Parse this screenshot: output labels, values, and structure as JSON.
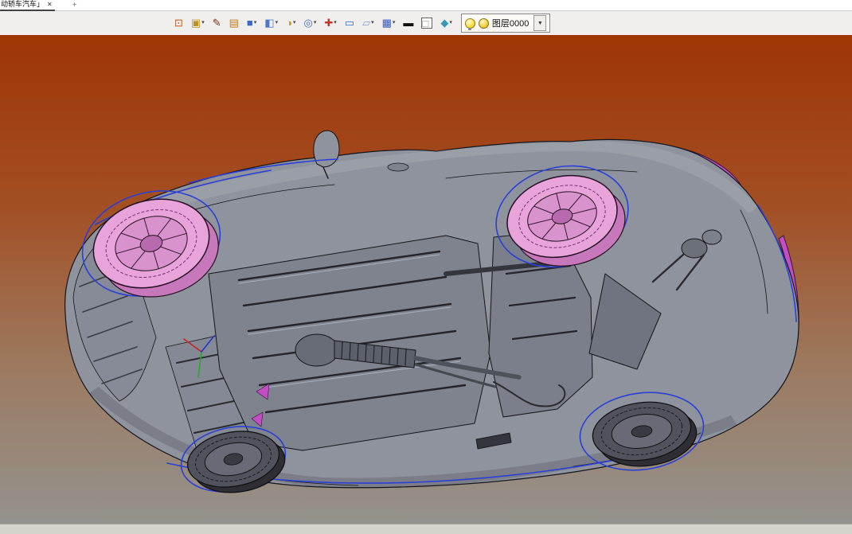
{
  "tabbar": {
    "tab_title": "动轿车汽车」",
    "close_glyph": "✕",
    "new_tab_glyph": "+"
  },
  "toolbar": {
    "dropdown_glyph": "▾",
    "icons": [
      {
        "name": "import-view-icon",
        "glyph": "⊡",
        "color": "#b85c20",
        "dropdown": false
      },
      {
        "name": "render-style-icon",
        "glyph": "▣",
        "color": "#c09020",
        "dropdown": true
      },
      {
        "name": "sketch-pen-icon",
        "glyph": "✎",
        "color": "#7a3010",
        "dropdown": false
      },
      {
        "name": "solid-box-icon",
        "glyph": "▤",
        "color": "#c07818",
        "dropdown": false
      },
      {
        "name": "extrude-cube-icon",
        "glyph": "■",
        "color": "#3a6ac8",
        "dropdown": true
      },
      {
        "name": "boolean-cube-icon",
        "glyph": "◧",
        "color": "#4a76d0",
        "dropdown": true
      },
      {
        "name": "sphere-part-icon",
        "glyph": "◑",
        "color": "#d09820",
        "dropdown": true
      },
      {
        "name": "zoom-search-icon",
        "glyph": "◎",
        "color": "#3a6ac8",
        "dropdown": true
      },
      {
        "name": "move-orient-icon",
        "glyph": "✚",
        "color": "#c03828",
        "dropdown": true
      },
      {
        "name": "select-window-icon",
        "glyph": "▭",
        "color": "#3a6ac8",
        "dropdown": false
      },
      {
        "name": "plane-grid-icon",
        "glyph": "▱",
        "color": "#8898c8",
        "dropdown": true
      },
      {
        "name": "display-screen-icon",
        "glyph": "▦",
        "color": "#3858b8",
        "dropdown": true
      },
      {
        "name": "line-width-icon",
        "glyph": "▬",
        "color": "#101010",
        "dropdown": false
      },
      {
        "name": "color-swatch-icon",
        "glyph": "□",
        "color": "#909090",
        "dropdown": false
      },
      {
        "name": "material-shade-icon",
        "glyph": "◆",
        "color": "#3898b8",
        "dropdown": true
      }
    ],
    "layer": {
      "label": "图层0000",
      "dropdown_glyph": "▼"
    }
  },
  "viewport": {
    "gradient_stops": [
      {
        "color": "#9e3505",
        "pos": "0%"
      },
      {
        "color": "#a34f24",
        "pos": "35%"
      },
      {
        "color": "#9c7a60",
        "pos": "68%"
      },
      {
        "color": "#94928d",
        "pos": "100%"
      }
    ],
    "model_colors": {
      "body_gray": "#8f939e",
      "panel_gray": "#7e838e",
      "edge_blue": "#2b3fd6",
      "wheel_pink": "#e7a3da",
      "wheel_pink_dark": "#c678ba",
      "body_magenta": "#c34ec4",
      "wireframe": "#15151a"
    }
  }
}
